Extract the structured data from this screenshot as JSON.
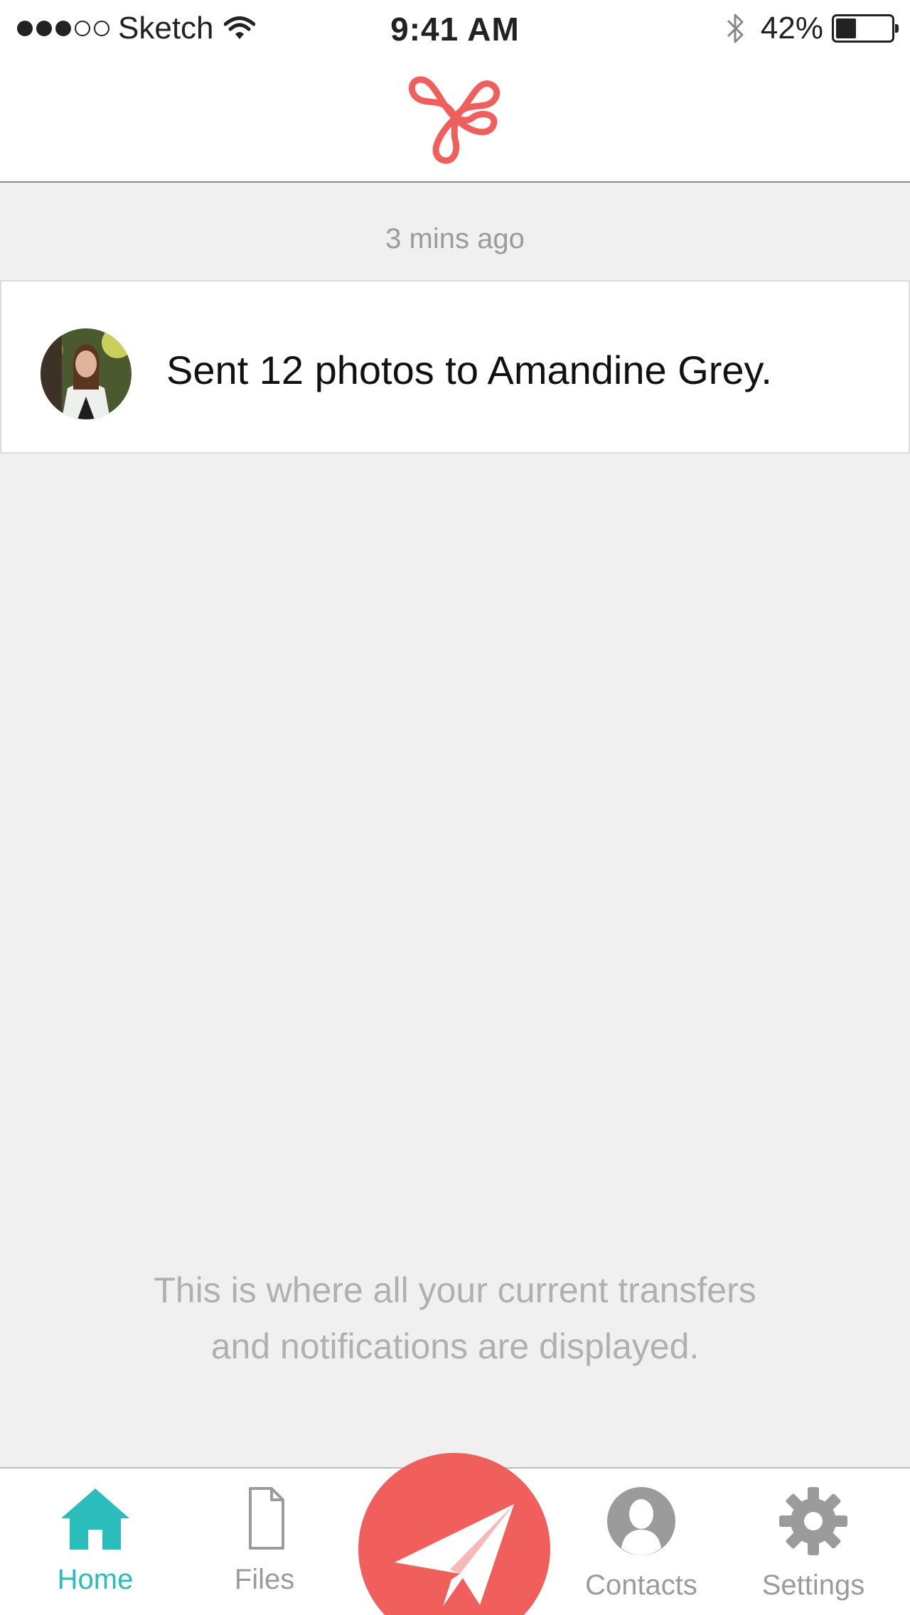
{
  "status_bar": {
    "carrier": "Sketch",
    "time": "9:41 AM",
    "battery_percent": "42%",
    "battery_level": 0.42,
    "signal_bars_filled": 3,
    "signal_bars_total": 5
  },
  "header": {
    "logo_icon": "clover-knot-logo",
    "accent_color": "#f05f5c"
  },
  "feed": {
    "timestamp": "3 mins ago",
    "notifications": [
      {
        "text": "Sent 12 photos to Amandine Grey.",
        "avatar": "user-avatar"
      }
    ],
    "empty_message_line1": "This is where all your current transfers",
    "empty_message_line2": "and notifications are displayed."
  },
  "tab_bar": {
    "tabs": [
      {
        "label": "Home",
        "icon": "home-icon",
        "active": true
      },
      {
        "label": "Files",
        "icon": "file-icon",
        "active": false
      },
      {
        "label": "Contacts",
        "icon": "contact-icon",
        "active": false
      },
      {
        "label": "Settings",
        "icon": "gear-icon",
        "active": false
      }
    ],
    "send_icon": "paper-plane-icon",
    "active_color": "#2bbcbc",
    "send_color": "#f05f5c"
  }
}
